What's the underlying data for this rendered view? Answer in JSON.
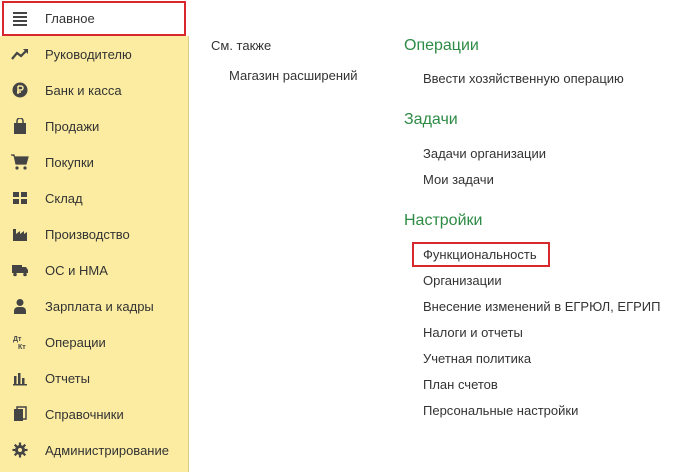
{
  "sidebar": {
    "items": [
      {
        "label": "Главное",
        "icon": "hamburger-menu-icon"
      },
      {
        "label": "Руководителю",
        "icon": "trend-chart-icon"
      },
      {
        "label": "Банк и касса",
        "icon": "ruble-coin-icon"
      },
      {
        "label": "Продажи",
        "icon": "shopping-bag-icon"
      },
      {
        "label": "Покупки",
        "icon": "shopping-cart-icon"
      },
      {
        "label": "Склад",
        "icon": "warehouse-grid-icon"
      },
      {
        "label": "Производство",
        "icon": "factory-icon"
      },
      {
        "label": "ОС и НМА",
        "icon": "truck-icon"
      },
      {
        "label": "Зарплата и кадры",
        "icon": "person-icon"
      },
      {
        "label": "Операции",
        "icon": "debit-credit-icon"
      },
      {
        "label": "Отчеты",
        "icon": "bar-chart-icon"
      },
      {
        "label": "Справочники",
        "icon": "books-icon"
      },
      {
        "label": "Администрирование",
        "icon": "gear-icon"
      }
    ],
    "active_index": 0
  },
  "see_also": {
    "title": "См. также",
    "links": [
      "Магазин расширений"
    ]
  },
  "sections": {
    "operations": {
      "title": "Операции",
      "links": [
        "Ввести хозяйственную операцию"
      ]
    },
    "tasks": {
      "title": "Задачи",
      "links": [
        "Задачи организации",
        "Мои задачи"
      ]
    },
    "settings": {
      "title": "Настройки",
      "links": [
        "Функциональность",
        "Организации",
        "Внесение изменений в ЕГРЮЛ, ЕГРИП",
        "Налоги и отчеты",
        "Учетная политика",
        "План счетов",
        "Персональные настройки"
      ]
    }
  },
  "colors": {
    "sidebar_bg": "#fbeca1",
    "section_title": "#2e8b45",
    "highlight": "#d9272e"
  }
}
